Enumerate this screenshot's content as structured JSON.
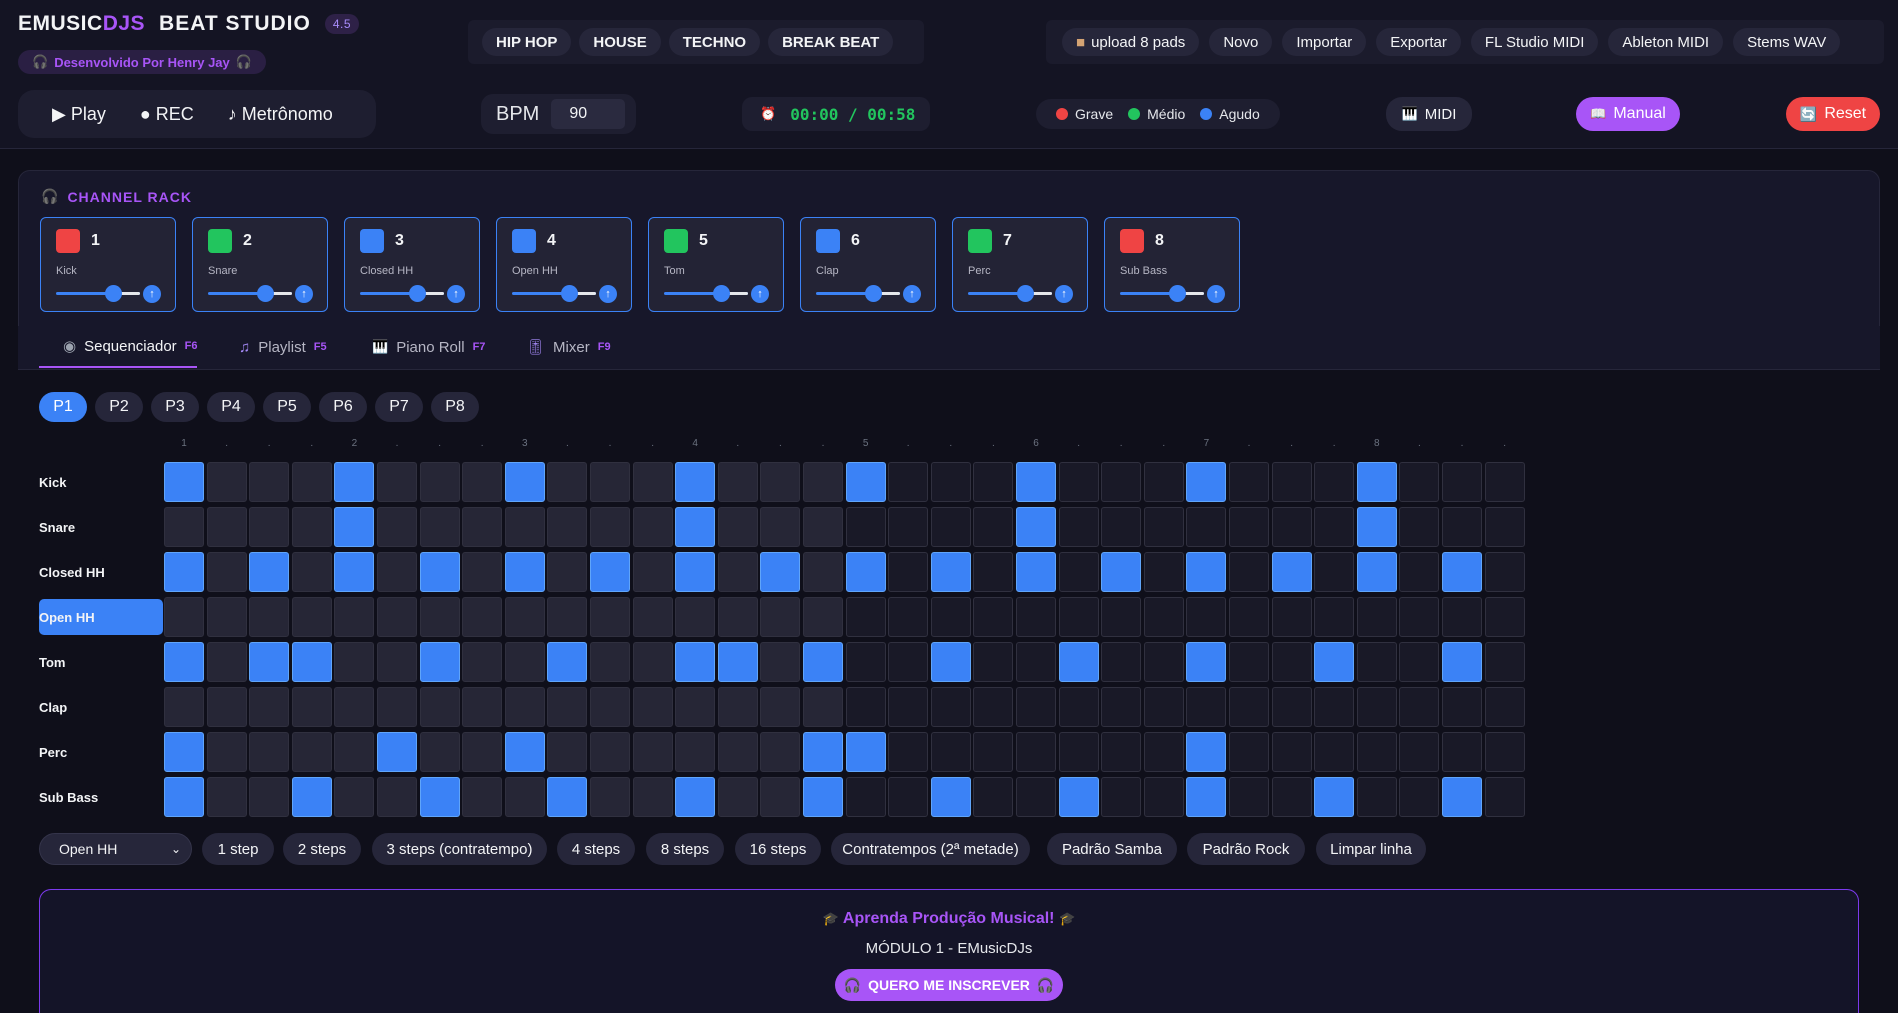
{
  "header": {
    "brand_part1": "EMUSIC",
    "brand_part2": "DJS",
    "brand_part3": "BEAT STUDIO",
    "version": "4.5",
    "credit": "Desenvolvido Por Henry Jay",
    "credit_icon": "headphones-icon"
  },
  "genres": [
    "HIP HOP",
    "HOUSE",
    "TECHNO",
    "BREAK BEAT"
  ],
  "export_buttons": [
    "upload 8 pads",
    "Novo",
    "Importar",
    "Exportar",
    "FL Studio MIDI",
    "Ableton MIDI",
    "Stems WAV"
  ],
  "transport": {
    "play": "▶ Play",
    "rec": "● REC",
    "metronome": "♪ Metrônomo"
  },
  "bpm": {
    "label": "BPM",
    "value": "90"
  },
  "timer": {
    "icon": "alarm-clock-icon",
    "text": "00:00 / 00:58"
  },
  "legend": [
    {
      "label": "Grave",
      "color": "#ef4444"
    },
    {
      "label": "Médio",
      "color": "#22c55e"
    },
    {
      "label": "Agudo",
      "color": "#3b82f6"
    }
  ],
  "midi_label": "MIDI",
  "manual_label": "Manual",
  "reset_label": "Reset",
  "rack": {
    "title": "CHANNEL RACK",
    "channels": [
      {
        "num": "1",
        "name": "Kick",
        "color": "#ef4444"
      },
      {
        "num": "2",
        "name": "Snare",
        "color": "#22c55e"
      },
      {
        "num": "3",
        "name": "Closed HH",
        "color": "#3b82f6"
      },
      {
        "num": "4",
        "name": "Open HH",
        "color": "#3b82f6"
      },
      {
        "num": "5",
        "name": "Tom",
        "color": "#22c55e"
      },
      {
        "num": "6",
        "name": "Clap",
        "color": "#3b82f6"
      },
      {
        "num": "7",
        "name": "Perc",
        "color": "#22c55e"
      },
      {
        "num": "8",
        "name": "Sub Bass",
        "color": "#ef4444"
      }
    ]
  },
  "tabs": [
    {
      "label": "Sequenciador",
      "key": "F6",
      "active": true
    },
    {
      "label": "Playlist",
      "key": "F5"
    },
    {
      "label": "Piano Roll",
      "key": "F7"
    },
    {
      "label": "Mixer",
      "key": "F9"
    }
  ],
  "patterns": [
    "P1",
    "P2",
    "P3",
    "P4",
    "P5",
    "P6",
    "P7",
    "P8"
  ],
  "active_pattern": "P1",
  "beat_markers": [
    "1",
    ".",
    ".",
    ".",
    "2",
    ".",
    ".",
    ".",
    "3",
    ".",
    ".",
    ".",
    "4",
    ".",
    ".",
    ".",
    "5",
    ".",
    ".",
    ".",
    "6",
    ".",
    ".",
    ".",
    "7",
    ".",
    ".",
    ".",
    "8",
    ".",
    ".",
    "."
  ],
  "sequencer": {
    "selected_row": "Open HH",
    "rows": [
      {
        "name": "Kick",
        "steps": [
          1,
          0,
          0,
          0,
          1,
          0,
          0,
          0,
          1,
          0,
          0,
          0,
          1,
          0,
          0,
          0,
          1,
          0,
          0,
          0,
          1,
          0,
          0,
          0,
          1,
          0,
          0,
          0,
          1,
          0,
          0,
          0
        ]
      },
      {
        "name": "Snare",
        "steps": [
          0,
          0,
          0,
          0,
          1,
          0,
          0,
          0,
          0,
          0,
          0,
          0,
          1,
          0,
          0,
          0,
          0,
          0,
          0,
          0,
          1,
          0,
          0,
          0,
          0,
          0,
          0,
          0,
          1,
          0,
          0,
          0
        ]
      },
      {
        "name": "Closed HH",
        "steps": [
          1,
          0,
          1,
          0,
          1,
          0,
          1,
          0,
          1,
          0,
          1,
          0,
          1,
          0,
          1,
          0,
          1,
          0,
          1,
          0,
          1,
          0,
          1,
          0,
          1,
          0,
          1,
          0,
          1,
          0,
          1,
          0
        ]
      },
      {
        "name": "Open HH",
        "steps": [
          0,
          0,
          0,
          0,
          0,
          0,
          0,
          0,
          0,
          0,
          0,
          0,
          0,
          0,
          0,
          0,
          0,
          0,
          0,
          0,
          0,
          0,
          0,
          0,
          0,
          0,
          0,
          0,
          0,
          0,
          0,
          0
        ]
      },
      {
        "name": "Tom",
        "steps": [
          1,
          0,
          1,
          1,
          0,
          0,
          1,
          0,
          0,
          1,
          0,
          0,
          1,
          1,
          0,
          1,
          0,
          0,
          1,
          0,
          0,
          1,
          0,
          0,
          1,
          0,
          0,
          1,
          0,
          0,
          1,
          0
        ]
      },
      {
        "name": "Clap",
        "steps": [
          0,
          0,
          0,
          0,
          0,
          0,
          0,
          0,
          0,
          0,
          0,
          0,
          0,
          0,
          0,
          0,
          0,
          0,
          0,
          0,
          0,
          0,
          0,
          0,
          0,
          0,
          0,
          0,
          0,
          0,
          0,
          0
        ]
      },
      {
        "name": "Perc",
        "steps": [
          1,
          0,
          0,
          0,
          0,
          1,
          0,
          0,
          1,
          0,
          0,
          0,
          0,
          0,
          0,
          1,
          1,
          0,
          0,
          0,
          0,
          0,
          0,
          0,
          1,
          0,
          0,
          0,
          0,
          0,
          0,
          0
        ]
      },
      {
        "name": "Sub Bass",
        "steps": [
          1,
          0,
          0,
          1,
          0,
          0,
          1,
          0,
          0,
          1,
          0,
          0,
          1,
          0,
          0,
          1,
          0,
          0,
          1,
          0,
          0,
          1,
          0,
          0,
          1,
          0,
          0,
          1,
          0,
          0,
          1,
          0
        ]
      }
    ]
  },
  "fill_buttons": [
    "1 step",
    "2 steps",
    "3 steps (contratempo)",
    "4 steps",
    "8 steps",
    "16 steps",
    "Contratempos (2ª metade)",
    "Padrão Samba",
    "Padrão Rock",
    "Limpar linha"
  ],
  "promo": {
    "title": "Aprenda Produção Musical!",
    "subtitle": "MÓDULO 1 - EMusicDJs",
    "button": "QUERO ME INSCREVER"
  }
}
